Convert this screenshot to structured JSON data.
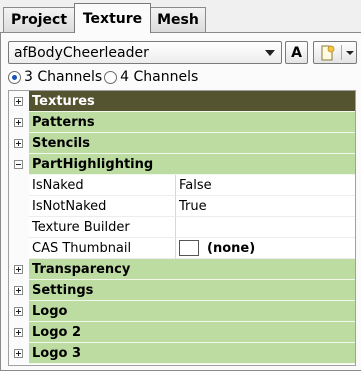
{
  "tabs": [
    {
      "label": "Project",
      "active": false
    },
    {
      "label": "Texture",
      "active": true
    },
    {
      "label": "Mesh",
      "active": false
    }
  ],
  "resource_selector": {
    "value": "afBodyCheerleader"
  },
  "buttons": {
    "a_label": "A"
  },
  "channels": {
    "option1": "3 Channels",
    "option2": "4 Channels",
    "selected": "3 Channels"
  },
  "grid": {
    "categories_top": [
      {
        "label": "Textures",
        "expanded": false,
        "selected": true
      },
      {
        "label": "Patterns",
        "expanded": false
      },
      {
        "label": "Stencils",
        "expanded": false
      },
      {
        "label": "PartHighlighting",
        "expanded": true
      }
    ],
    "properties": [
      {
        "name": "IsNaked",
        "value": "False"
      },
      {
        "name": "IsNotNaked",
        "value": "True"
      },
      {
        "name": "Texture Builder",
        "value": ""
      },
      {
        "name": "CAS Thumbnail",
        "value": "(none)"
      }
    ],
    "categories_bottom": [
      {
        "label": "Transparency",
        "expanded": false
      },
      {
        "label": "Settings",
        "expanded": false
      },
      {
        "label": "Logo",
        "expanded": false
      },
      {
        "label": "Logo 2",
        "expanded": false
      },
      {
        "label": "Logo 3",
        "expanded": false
      }
    ]
  },
  "colors": {
    "category_bg": "#bddca1",
    "selected_bg": "#545431"
  }
}
